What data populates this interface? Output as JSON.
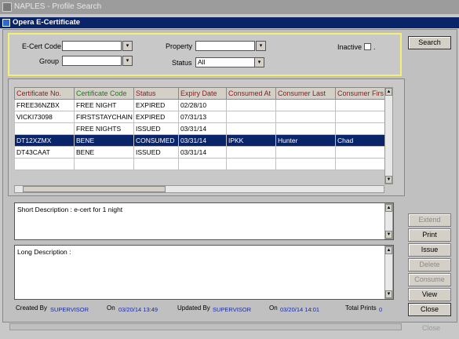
{
  "window": {
    "outer_title": "NAPLES - Profile Search",
    "inner_title": "Opera E-Certificate"
  },
  "criteria": {
    "ecert_code_label": "E-Cert Code",
    "ecert_code_value": "",
    "group_label": "Group",
    "group_value": "",
    "property_label": "Property",
    "property_value": "",
    "status_label": "Status",
    "status_value": "All",
    "inactive_label": "Inactive",
    "inactive_dot": ".",
    "dropdown_glyph": "▾"
  },
  "buttons": {
    "search": "Search",
    "extend": "Extend",
    "print": "Print",
    "issue": "Issue",
    "delete": "Delete",
    "consume": "Consume",
    "view": "View",
    "close": "Close"
  },
  "grid": {
    "columns": [
      {
        "label": "Certificate No.",
        "color": "#8b1a1a"
      },
      {
        "label": "Certificate Code",
        "color": "#1a7a1a"
      },
      {
        "label": "Status",
        "color": "#8b1a1a"
      },
      {
        "label": "Expiry Date",
        "color": "#8b1a1a"
      },
      {
        "label": "Consumed At",
        "color": "#8b1a1a"
      },
      {
        "label": "Consumer Last",
        "color": "#8b1a1a"
      },
      {
        "label": "Consumer Firs",
        "color": "#8b1a1a"
      }
    ],
    "rows": [
      [
        "FREE36NZBX",
        "FREE NIGHT",
        "EXPIRED",
        "02/28/10",
        "",
        "",
        ""
      ],
      [
        "VICKI73098",
        "FIRSTSTAYCHAIN",
        "EXPIRED",
        "07/31/13",
        "",
        "",
        ""
      ],
      [
        "",
        "FREE NIGHTS",
        "ISSUED",
        "03/31/14",
        "",
        "",
        ""
      ],
      [
        "DT12XZMX",
        "BENE",
        "CONSUMED",
        "03/31/14",
        "IPKK",
        "Hunter",
        "Chad"
      ],
      [
        "DT43CAAT",
        "BENE",
        "ISSUED",
        "03/31/14",
        "",
        "",
        ""
      ],
      [
        "",
        "",
        "",
        "",
        "",
        "",
        ""
      ],
      [
        "",
        "",
        "",
        "",
        "",
        "",
        ""
      ]
    ],
    "selected_row": 3
  },
  "short_description": "Short Description : e-cert for 1 night",
  "long_description": "Long Description :",
  "footer": {
    "created_by_label": "Created By",
    "created_by_value": "SUPERVISOR",
    "on_label": "On",
    "created_on_value": "03/20/14 13:49",
    "updated_by_label": "Updated By",
    "updated_by_value": "SUPERVISOR",
    "updated_on_label": "On",
    "updated_on_value": "03/20/14 14:01",
    "total_prints_label": "Total Prints",
    "total_prints_value": "0"
  },
  "ghost_close": "Close",
  "scroll_arrows": {
    "up": "▲",
    "down": "▼"
  }
}
